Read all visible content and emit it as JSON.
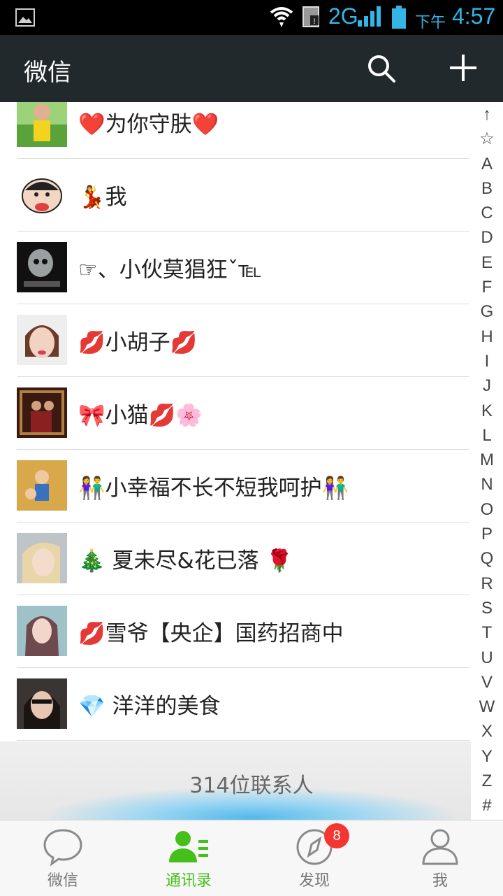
{
  "status_bar": {
    "network": "2G",
    "ampm": "下午",
    "time": "4:57"
  },
  "header": {
    "title": "微信"
  },
  "contacts": [
    {
      "name": "❤️为你守肤❤️"
    },
    {
      "name": "💃我"
    },
    {
      "name": "☞、小伙莫猖狂ˇ℡"
    },
    {
      "name": "💋小胡子💋"
    },
    {
      "name": "🎀小猫💋🌸"
    },
    {
      "name": "👫小幸福不长不短我呵护👫"
    },
    {
      "name": "🎄 夏未尽&花已落 🌹"
    },
    {
      "name": "💋雪爷【央企】国药招商中"
    },
    {
      "name": "💎 洋洋的美食"
    }
  ],
  "index": [
    "↑",
    "☆",
    "A",
    "B",
    "C",
    "D",
    "E",
    "F",
    "G",
    "H",
    "I",
    "J",
    "K",
    "L",
    "M",
    "N",
    "O",
    "P",
    "Q",
    "R",
    "S",
    "T",
    "U",
    "V",
    "W",
    "X",
    "Y",
    "Z",
    "#"
  ],
  "footer": {
    "count": "314位联系人"
  },
  "bottom_nav": {
    "tabs": [
      {
        "label": "微信"
      },
      {
        "label": "通讯录"
      },
      {
        "label": "发现",
        "badge": "8"
      },
      {
        "label": "我"
      }
    ]
  },
  "colors": {
    "header_bg": "#22292c",
    "accent_green": "#45c01a",
    "badge_red": "#f43530",
    "status_blue": "#33b5e5"
  }
}
